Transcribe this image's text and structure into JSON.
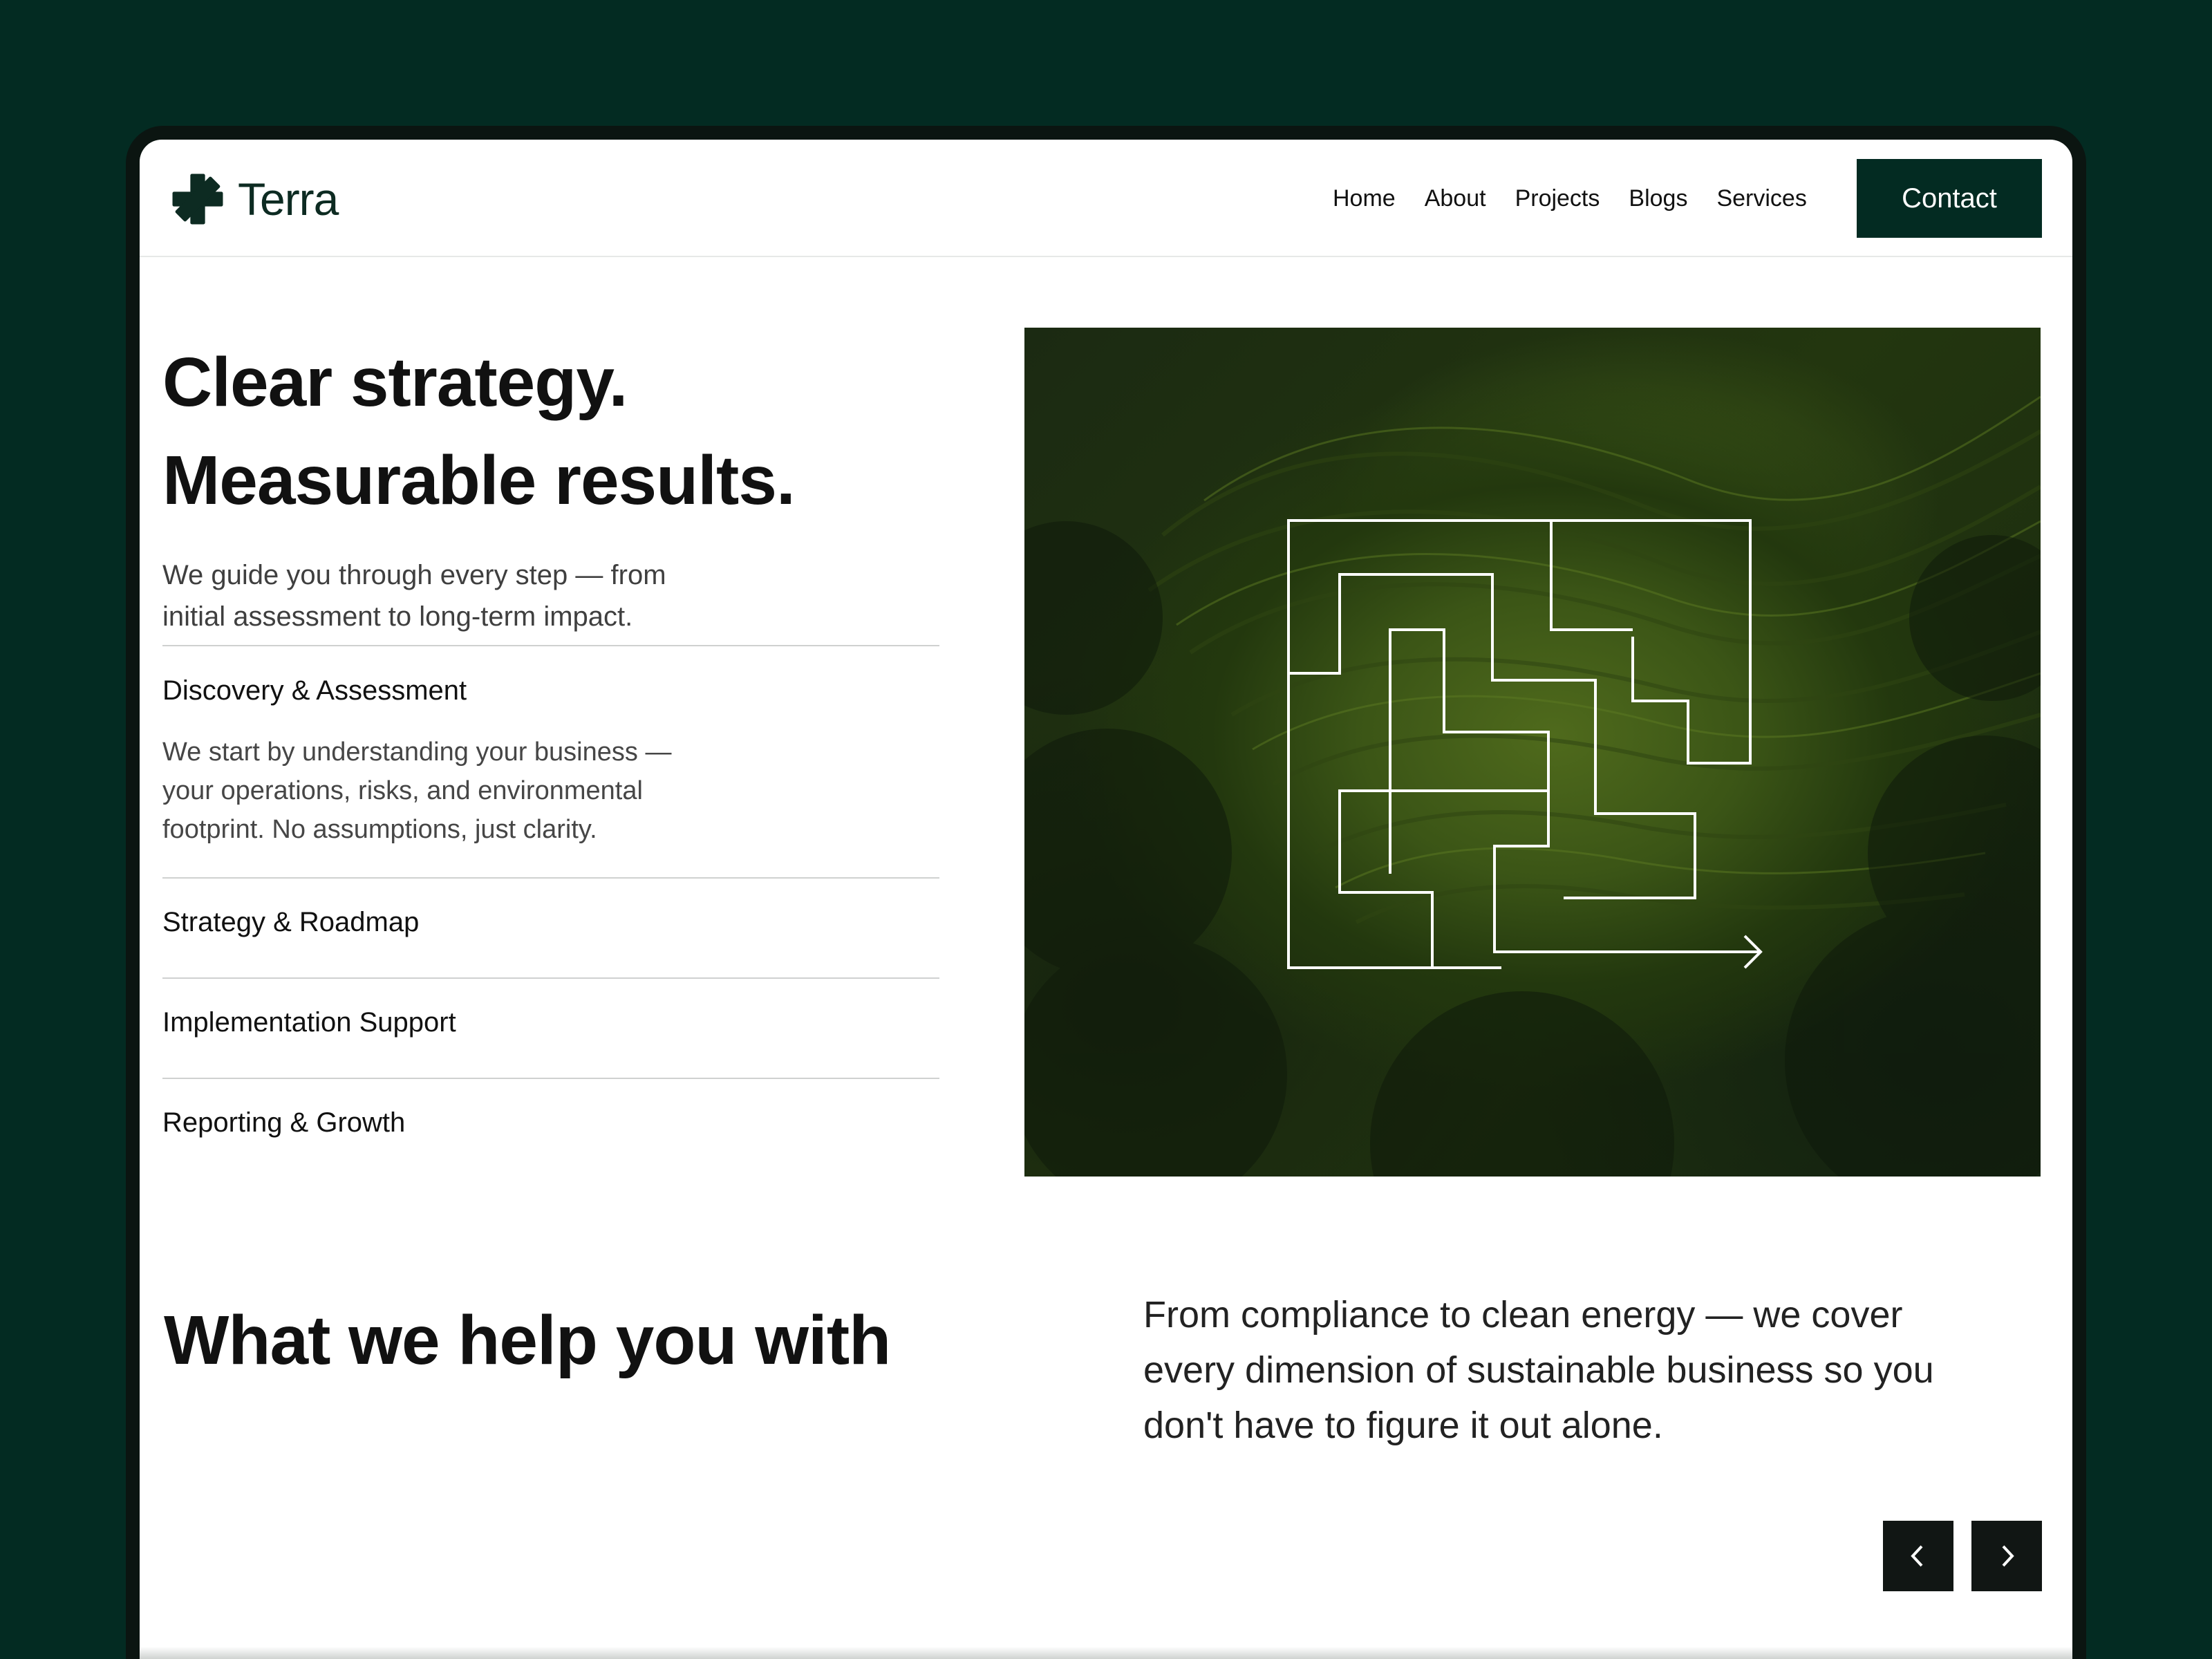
{
  "brand": {
    "name": "Terra"
  },
  "nav": {
    "items": [
      "Home",
      "About",
      "Projects",
      "Blogs",
      "Services"
    ],
    "contact_label": "Contact"
  },
  "hero": {
    "title_line1": "Clear strategy.",
    "title_line2": "Measurable results.",
    "subtitle_line1": "We guide you through every step — from",
    "subtitle_line2": "initial assessment to long-term impact."
  },
  "steps": [
    {
      "title": "Discovery & Assessment",
      "desc_line1": "We start by understanding your business —",
      "desc_line2": "your operations, risks, and environmental",
      "desc_line3": "footprint. No assumptions, just clarity.",
      "expanded": true
    },
    {
      "title": "Strategy & Roadmap",
      "expanded": false
    },
    {
      "title": "Implementation Support",
      "expanded": false
    },
    {
      "title": "Reporting & Growth",
      "expanded": false
    }
  ],
  "services": {
    "title": "What we help you with",
    "desc_line1": "From compliance to clean energy — we cover",
    "desc_line2": "every  dimension of sustainable business so you",
    "desc_line3": "don't  have to figure it out alone."
  },
  "icons": {
    "logo": "asterisk-logo-icon",
    "prev": "chevron-left-icon",
    "next": "chevron-right-icon"
  },
  "colors": {
    "brand_dark": "#032b22",
    "text": "#111111",
    "white": "#ffffff"
  }
}
